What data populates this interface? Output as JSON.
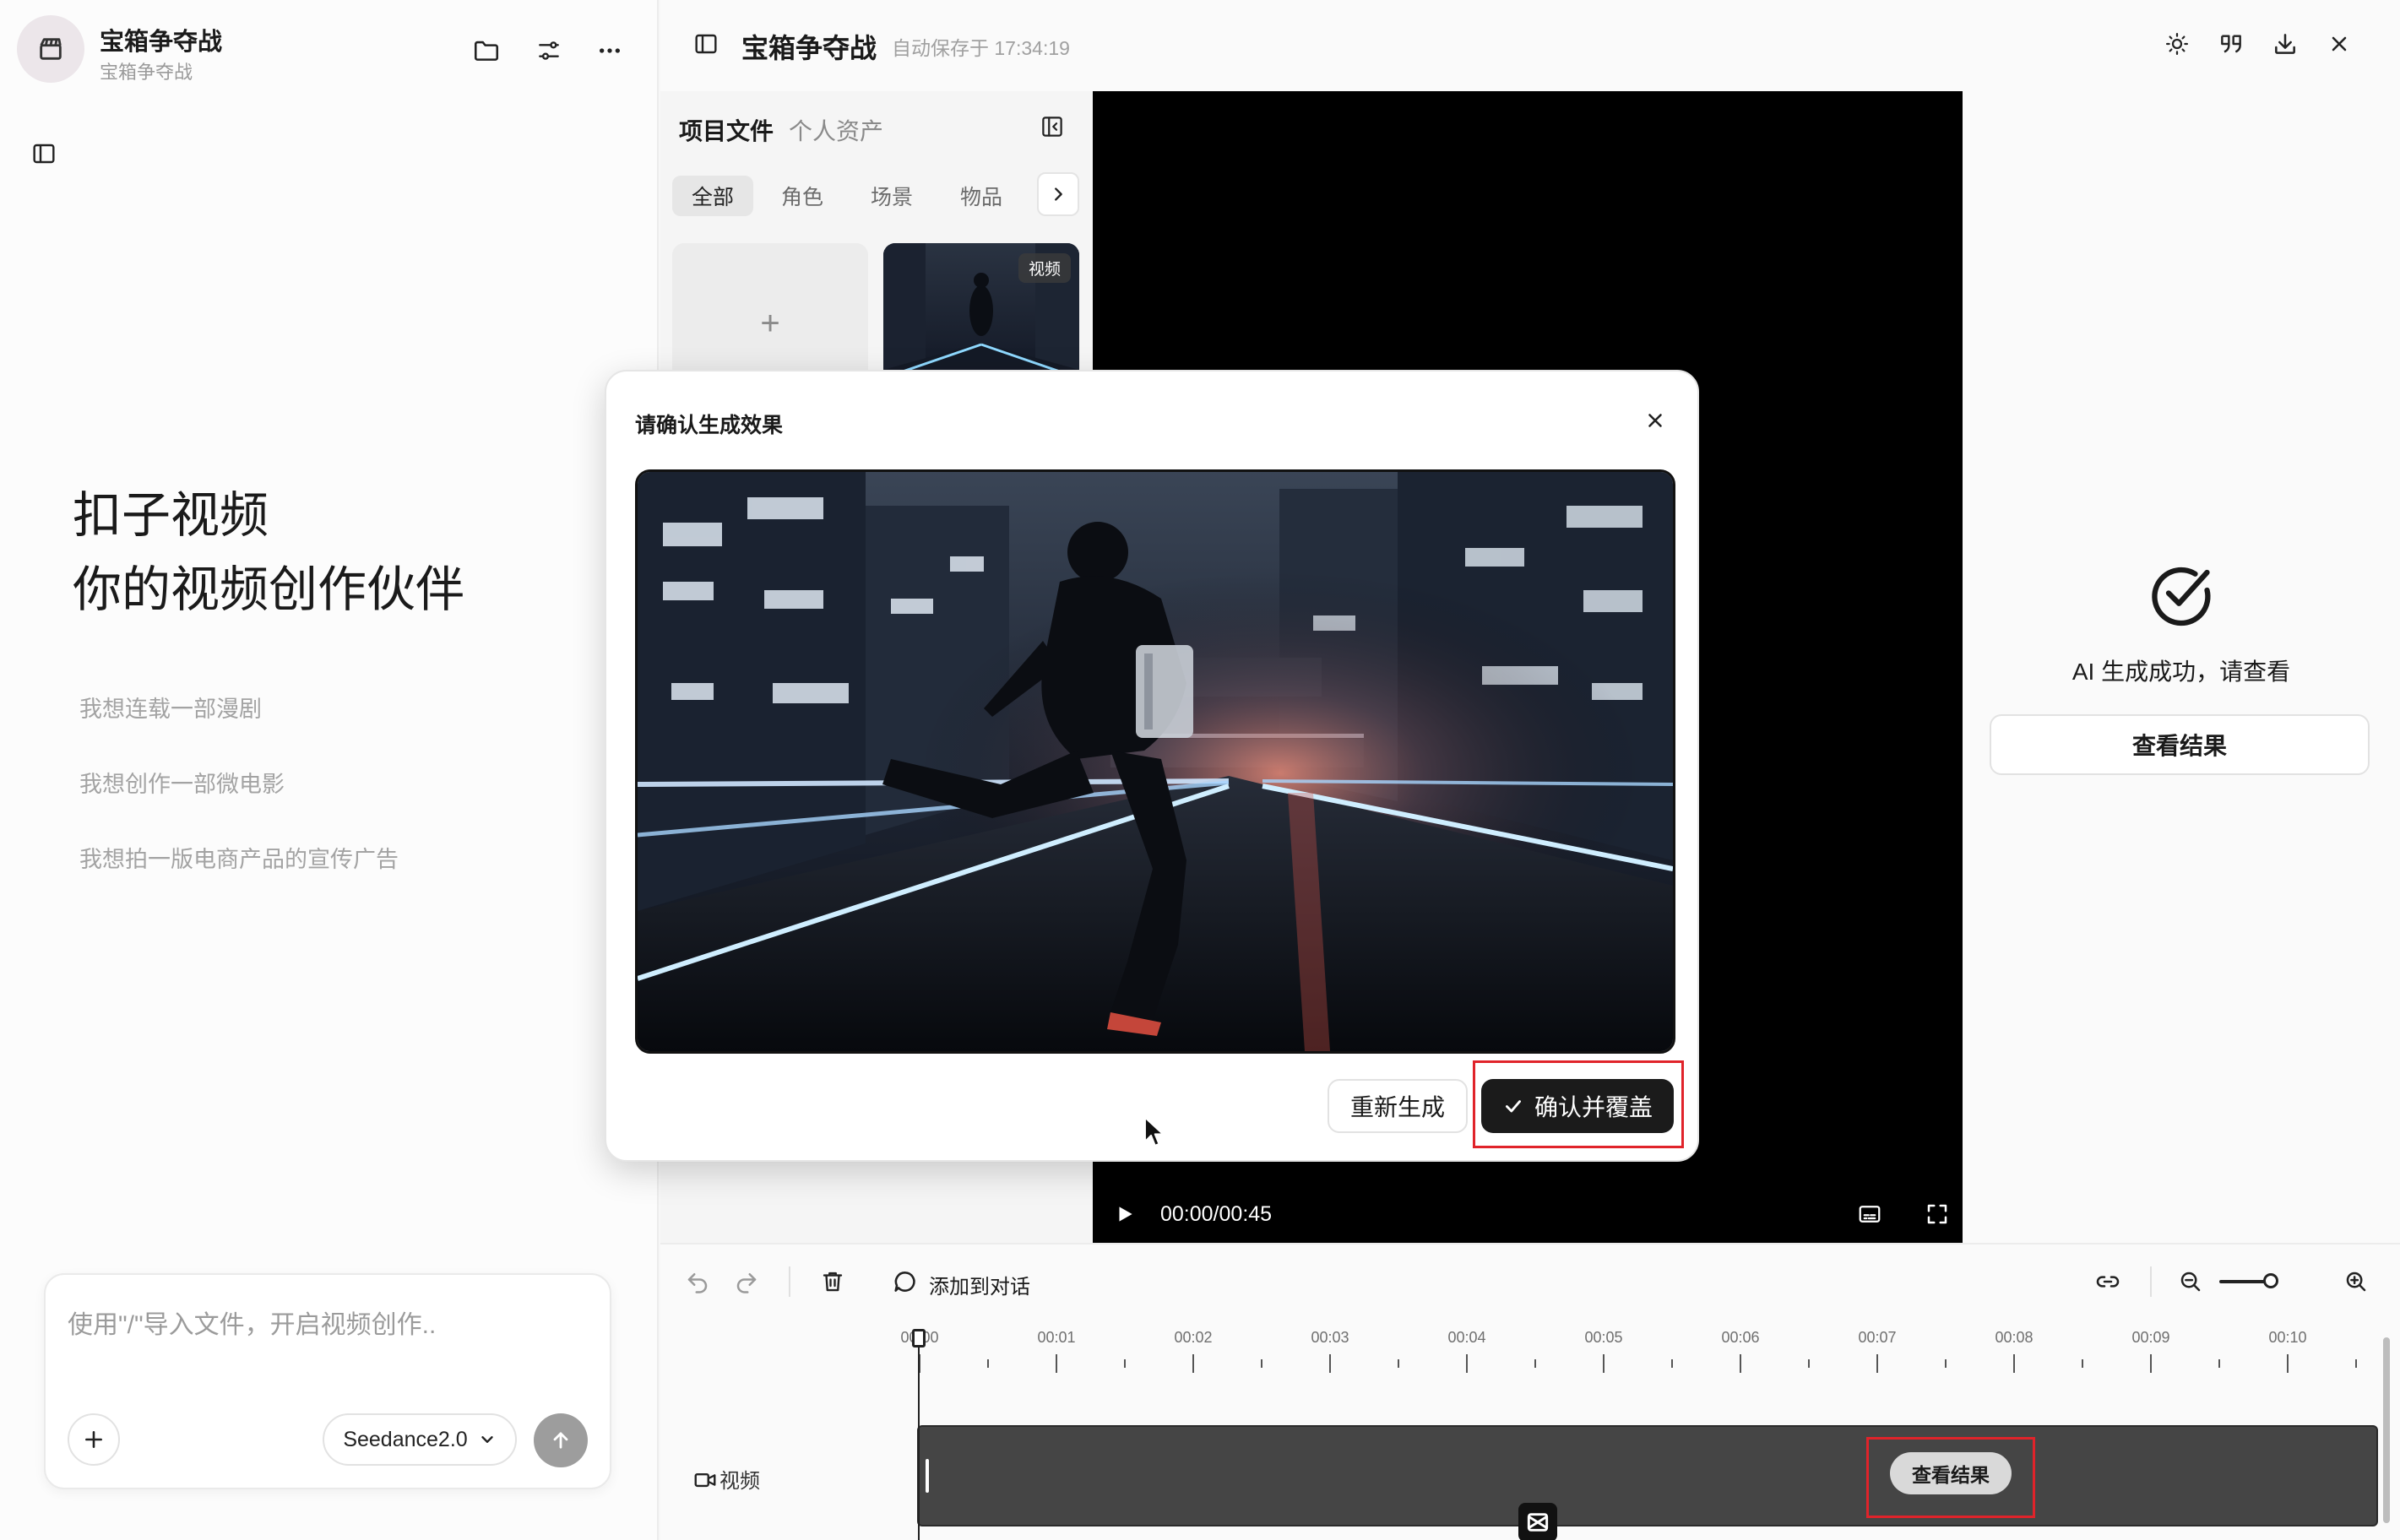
{
  "project": {
    "title": "宝箱争夺战",
    "subtitle": "宝箱争夺战"
  },
  "left": {
    "hero_line1": "扣子视频",
    "hero_line2": "你的视频创作伙伴",
    "suggestions": [
      "我想连载一部漫剧",
      "我想创作一部微电影",
      "我想拍一版电商产品的宣传广告"
    ],
    "composer": {
      "placeholder": "使用\"/\"导入文件，开启视频创作..",
      "model": "Seedance2.0"
    }
  },
  "topbar": {
    "title": "宝箱争夺战",
    "autosave": "自动保存于 17:34:19"
  },
  "assets": {
    "tab_project": "项目文件",
    "tab_personal": "个人资产",
    "filters": [
      "全部",
      "角色",
      "场景",
      "物品"
    ],
    "add_label": "+",
    "thumb_badge": "视频"
  },
  "player": {
    "time": "00:00/00:45"
  },
  "right": {
    "success_text": "AI 生成成功，请查看",
    "view_button": "查看结果"
  },
  "timeline": {
    "add_to_chat": "添加到对话",
    "ruler": [
      "00:00",
      "00:01",
      "00:02",
      "00:03",
      "00:04",
      "00:05",
      "00:06",
      "00:07",
      "00:08",
      "00:09",
      "00:10"
    ],
    "track_label": "视频",
    "track_button": "查看结果"
  },
  "modal": {
    "title": "请确认生成效果",
    "regenerate": "重新生成",
    "confirm": "确认并覆盖"
  },
  "colors": {
    "highlight": "#e0232a",
    "primary_dark": "#1b1b1b",
    "send_disabled": "#9d9d9d"
  }
}
